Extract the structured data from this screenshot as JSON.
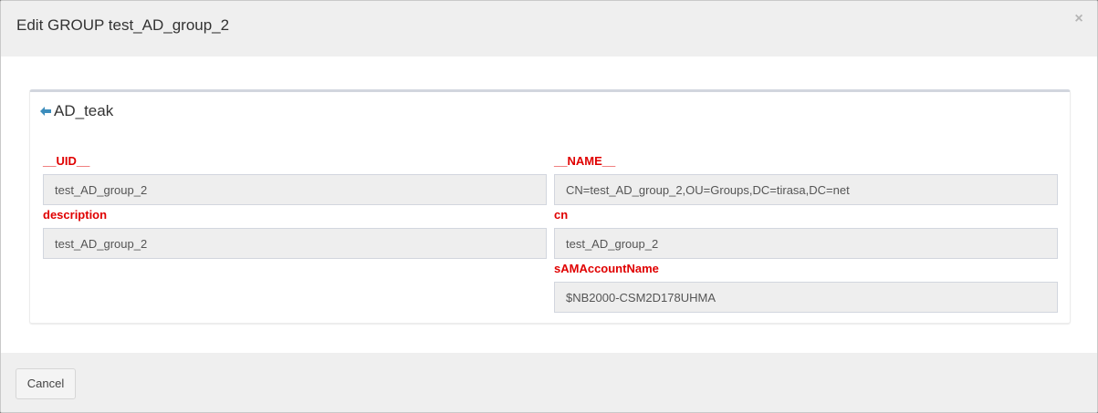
{
  "modal": {
    "title": "Edit GROUP test_AD_group_2",
    "close_glyph": "×"
  },
  "box": {
    "back_icon": "arrow-left-icon",
    "title": "AD_teak",
    "accent_color": "#3c8dbc"
  },
  "fields": [
    {
      "label": "__UID__",
      "value": "test_AD_group_2"
    },
    {
      "label": "__NAME__",
      "value": "CN=test_AD_group_2,OU=Groups,DC=tirasa,DC=net"
    },
    {
      "label": "description",
      "value": "test_AD_group_2"
    },
    {
      "label": "cn",
      "value": "test_AD_group_2"
    },
    {
      "label": "sAMAccountName",
      "value": "$NB2000-CSM2D178UHMA"
    }
  ],
  "label_color": "#e00000",
  "footer": {
    "cancel_label": "Cancel"
  }
}
